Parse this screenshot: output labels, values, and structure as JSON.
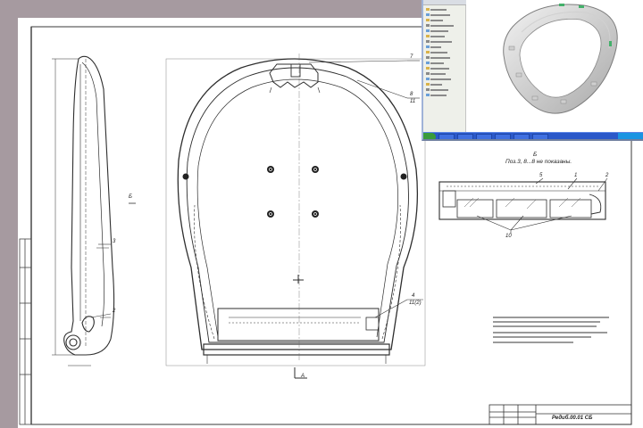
{
  "drawing": {
    "section_title": "Б",
    "section_note": "Поз.3, 8...8 не показаны.",
    "view_label": "Б",
    "bottom_view_label": "А",
    "drawing_number": "Редиб.00.01 СБ",
    "callouts": {
      "side_2": "2",
      "side_3": "3",
      "top_7": "7",
      "top_8": "8",
      "top_11": "11",
      "bottom_4": "4",
      "bottom_11": "11(2)",
      "right_1": "1",
      "right_2": "2",
      "right_5": "5",
      "right_10": "10"
    }
  },
  "cad_window": {
    "taskbar_buttons": 6
  },
  "colors": {
    "background": "#a69aa0",
    "sheet": "#ffffff",
    "line": "#2e2e2e",
    "taskbar": "#2a58c9",
    "start": "#3a9b3c"
  }
}
